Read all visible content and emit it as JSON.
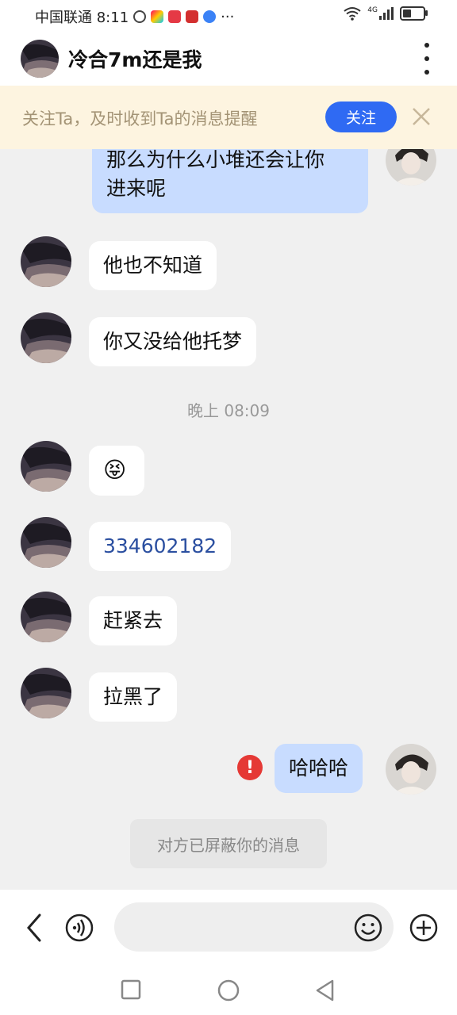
{
  "status_bar": {
    "carrier_time": "中国联通 8:11",
    "dots": "···",
    "network": "4G",
    "battery_level": 0.4
  },
  "header": {
    "title": "冷合7m还是我"
  },
  "banner": {
    "text": "关注Ta，及时收到Ta的消息提醒",
    "follow_label": "关注"
  },
  "messages": {
    "m0": {
      "line1": "那么为什么小堆还会让你",
      "line2": "进来呢"
    },
    "m1": "他也不知道",
    "m2": "你又没给他托梦",
    "time": "晚上 08:09",
    "m3_emoji": "😝",
    "m4": "334602182",
    "m5": "赶紧去",
    "m6": "拉黑了",
    "m7": "哈哈哈",
    "m7_error": "!",
    "system_note": "对方已屏蔽你的消息"
  },
  "input": {
    "value": "",
    "placeholder": ""
  },
  "colors": {
    "accent": "#2f6af3",
    "outgoing_bubble": "#c8dcff",
    "banner_bg": "#fdf4e0",
    "error": "#e53935",
    "link": "#2b4fa0"
  }
}
